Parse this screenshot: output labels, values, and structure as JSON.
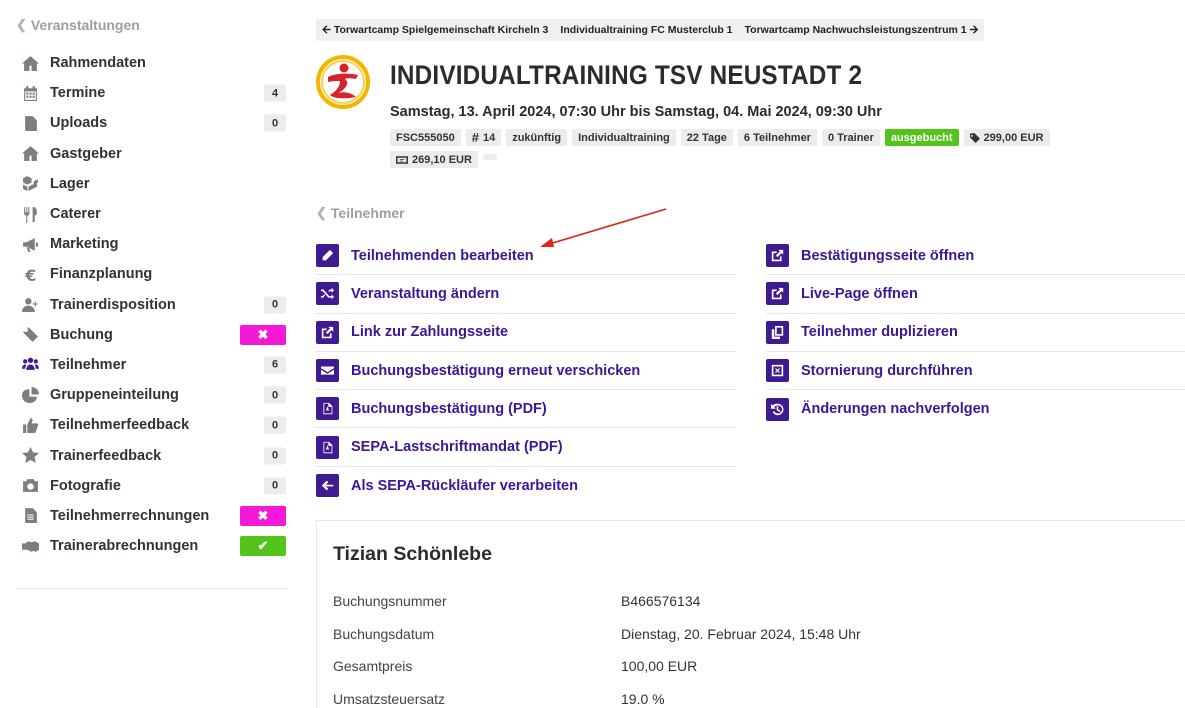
{
  "sidebar": {
    "back_label": "Veranstaltungen",
    "items": [
      {
        "label": "Rahmendaten",
        "icon": "home-icon"
      },
      {
        "label": "Termine",
        "icon": "calendar-icon",
        "count": "4"
      },
      {
        "label": "Uploads",
        "icon": "file-icon",
        "count": "0"
      },
      {
        "label": "Gastgeber",
        "icon": "home-icon"
      },
      {
        "label": "Lager",
        "icon": "cubes-icon"
      },
      {
        "label": "Caterer",
        "icon": "utensils-icon"
      },
      {
        "label": "Marketing",
        "icon": "bullhorn-icon"
      },
      {
        "label": "Finanzplanung",
        "icon": "euro-icon"
      },
      {
        "label": "Trainerdisposition",
        "icon": "user-plus-icon",
        "count": "0"
      },
      {
        "label": "Buchung",
        "icon": "ticket-icon",
        "status": "x"
      },
      {
        "label": "Teilnehmer",
        "icon": "users-icon",
        "count": "6"
      },
      {
        "label": "Gruppeneinteilung",
        "icon": "pie-chart-icon",
        "count": "0"
      },
      {
        "label": "Teilnehmerfeedback",
        "icon": "thumbs-up-icon",
        "count": "0"
      },
      {
        "label": "Trainerfeedback",
        "icon": "star-icon",
        "count": "0"
      },
      {
        "label": "Fotografie",
        "icon": "camera-icon",
        "count": "0"
      },
      {
        "label": "Teilnehmerrechnungen",
        "icon": "file-text-icon",
        "status": "x"
      },
      {
        "label": "Trainerabrechnungen",
        "icon": "handshake-icon",
        "status": "ok"
      }
    ],
    "status_x_symbol": "✖",
    "status_ok_symbol": "✔",
    "colors": {
      "badge_x": "#f319d7",
      "badge_ok": "#52c41a"
    }
  },
  "breadcrumbs": {
    "prev": "Torwartcamp Spielgemeinschaft Kircheln 3",
    "current": "Individualtraining FC Musterclub 1",
    "next": "Torwartcamp Nachwuchsleistungszentrum 1"
  },
  "event": {
    "title": "INDIVIDUALTRAINING TSV NEUSTADT 2",
    "dates": "Samstag, 13. April 2024, 07:30 Uhr bis Samstag, 04. Mai 2024, 09:30 Uhr",
    "tags": {
      "code": "FSC555050",
      "number": "14",
      "state": "zukünftig",
      "type": "Individualtraining",
      "days": "22 Tage",
      "participants": "6 Teilnehmer",
      "trainers": "0 Trainer",
      "booked": "ausgebucht",
      "price": "299,00 EUR",
      "net_price": "269,10 EUR"
    }
  },
  "section": {
    "back_label": "Teilnehmer"
  },
  "actions_left": [
    {
      "label": "Teilnehmenden bearbeiten",
      "icon": "pencil-icon"
    },
    {
      "label": "Veranstaltung ändern",
      "icon": "shuffle-icon"
    },
    {
      "label": "Link zur Zahlungsseite",
      "icon": "external-link-icon"
    },
    {
      "label": "Buchungsbestätigung erneut verschicken",
      "icon": "envelope-icon"
    },
    {
      "label": "Buchungsbestätigung (PDF)",
      "icon": "pdf-icon"
    },
    {
      "label": "SEPA-Lastschriftmandat (PDF)",
      "icon": "pdf-icon"
    },
    {
      "label": "Als SEPA-Rückläufer verarbeiten",
      "icon": "arrow-left-icon"
    }
  ],
  "actions_right": [
    {
      "label": "Bestätigungsseite öffnen",
      "icon": "external-link-icon"
    },
    {
      "label": "Live-Page öffnen",
      "icon": "external-link-icon"
    },
    {
      "label": "Teilnehmer duplizieren",
      "icon": "copy-icon"
    },
    {
      "label": "Stornierung durchführen",
      "icon": "close-box-icon"
    },
    {
      "label": "Änderungen nachverfolgen",
      "icon": "history-icon"
    }
  ],
  "participant": {
    "name": "Tizian Schönlebe",
    "fields": [
      {
        "label": "Buchungsnummer",
        "value": "B466576134"
      },
      {
        "label": "Buchungsdatum",
        "value": "Dienstag, 20. Februar 2024, 15:48 Uhr"
      },
      {
        "label": "Gesamtpreis",
        "value": "100,00 EUR"
      },
      {
        "label": "Umsatzsteuersatz",
        "value": "19.0 %"
      }
    ]
  },
  "colors": {
    "accent": "#3f1a91",
    "link": "#3a1796",
    "annotation_arrow": "#e3201b",
    "tag_green": "#52c41a"
  }
}
